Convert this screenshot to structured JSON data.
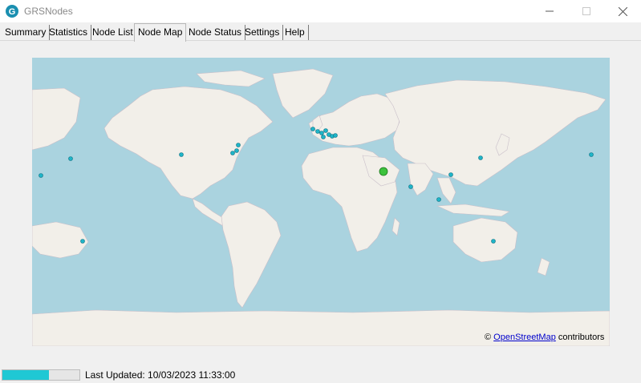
{
  "window": {
    "title": "GRSNodes",
    "app_icon": "g-logo-icon",
    "controls": [
      "minimize-icon",
      "maximize-icon",
      "close-icon"
    ]
  },
  "tabs": [
    {
      "label": "Summary",
      "active": false
    },
    {
      "label": "Statistics",
      "active": false
    },
    {
      "label": "Node List",
      "active": false
    },
    {
      "label": "Node Map",
      "active": true
    },
    {
      "label": "Node Status",
      "active": false
    },
    {
      "label": "Settings",
      "active": false
    },
    {
      "label": "Help",
      "active": false
    }
  ],
  "map": {
    "attribution_prefix": "©",
    "attribution_link": "OpenStreetMap",
    "attribution_suffix": "contributors",
    "colors": {
      "water": "#aad3df",
      "land": "#f2efe9",
      "border": "#b9a8b9",
      "node": "#1fb5c8",
      "home": "#3cc23c"
    }
  },
  "status": {
    "progress": 0.6,
    "last_updated": "Last Updated: 10/03/2023 11:33:00"
  }
}
